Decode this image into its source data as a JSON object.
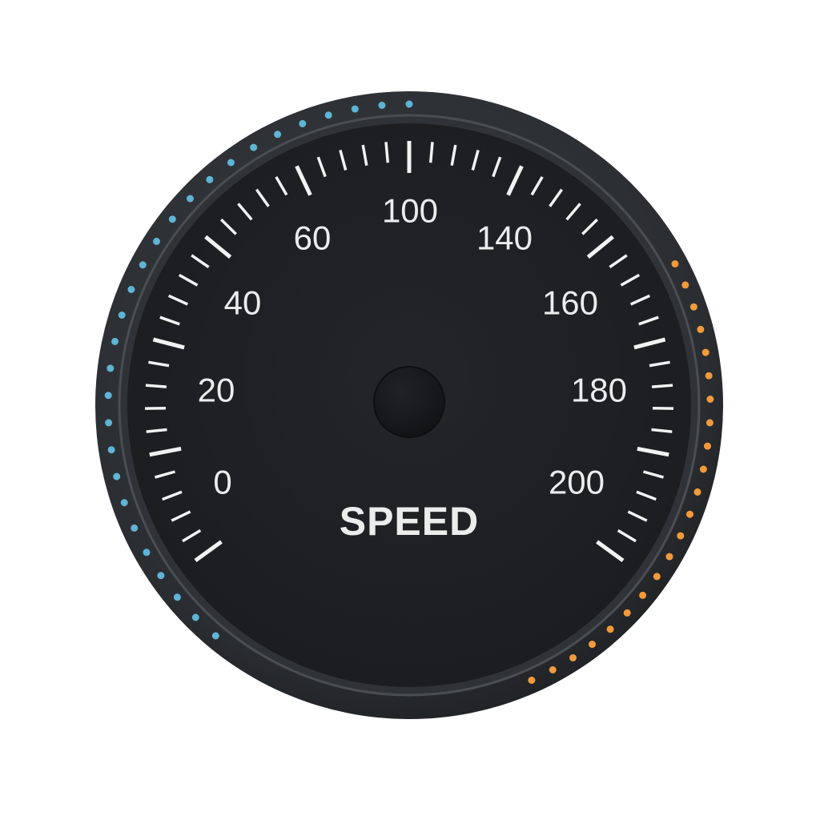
{
  "gauge": {
    "title": "SPEED",
    "scale_labels": [
      "0",
      "20",
      "40",
      "60",
      "100",
      "140",
      "160",
      "180",
      "200"
    ],
    "colors": {
      "bezel": "#2b2e32",
      "face": "#1e2023",
      "tick": "#f2f2f2",
      "text": "#ececec",
      "hub": "#151618",
      "led_cool": "#5fb4d6",
      "led_warm": "#f39a3a"
    }
  }
}
